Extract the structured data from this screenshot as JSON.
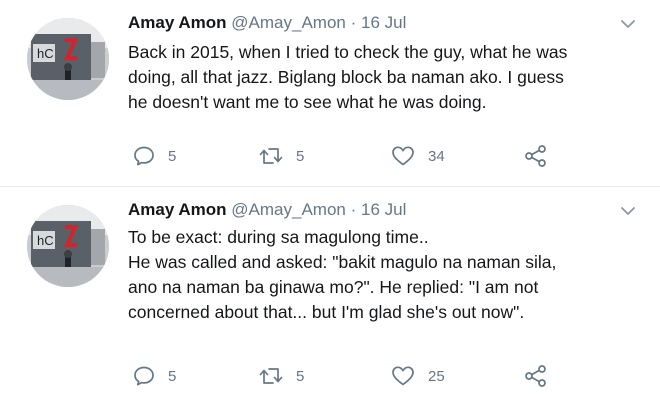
{
  "tweets": [
    {
      "author_name": "Amay Amon",
      "handle": "@Amay_Amon",
      "separator": "·",
      "date": "16 Jul",
      "text_lines": [
        "Back in 2015, when I tried to check the guy, what he was",
        "doing, all that jazz. Biglang block ba naman ako. I guess",
        "he doesn't want me to see what he was doing."
      ],
      "replies": "5",
      "retweets": "5",
      "likes": "34"
    },
    {
      "author_name": "Amay Amon",
      "handle": "@Amay_Amon",
      "separator": "·",
      "date": "16 Jul",
      "text_lines": [
        "To be exact: during sa magulong time..",
        "He was called and asked: \"bakit magulo na naman sila,",
        "ano na naman ba ginawa mo?\". He replied: \"I am not",
        "concerned about that... but I'm glad she's out now\"."
      ],
      "replies": "5",
      "retweets": "5",
      "likes": "25"
    }
  ],
  "icons": {
    "reply": "reply-icon",
    "retweet": "retweet-icon",
    "like": "heart-icon",
    "share": "share-icon",
    "menu": "chevron-down-icon"
  },
  "colors": {
    "text": "#14171a",
    "secondary": "#657786",
    "divider": "#e6ecf0"
  }
}
